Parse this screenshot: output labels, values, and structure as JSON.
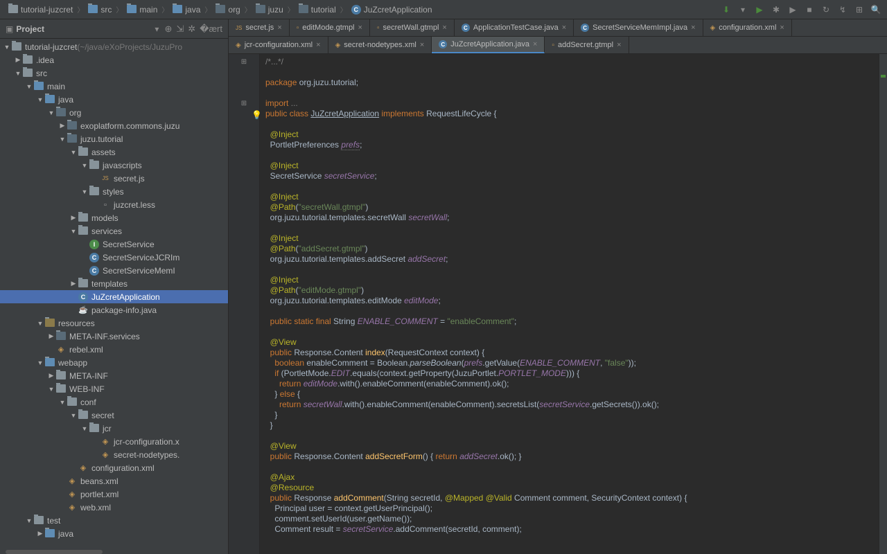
{
  "breadcrumb": [
    {
      "icon": "folder",
      "label": "tutorial-juzcret"
    },
    {
      "icon": "folder-src",
      "label": "src"
    },
    {
      "icon": "folder-src",
      "label": "main"
    },
    {
      "icon": "folder-src",
      "label": "java"
    },
    {
      "icon": "pkg",
      "label": "org"
    },
    {
      "icon": "pkg",
      "label": "juzu"
    },
    {
      "icon": "pkg",
      "label": "tutorial"
    },
    {
      "icon": "class",
      "label": "JuZcretApplication"
    }
  ],
  "sidebar": {
    "title": "Project",
    "toolIcons": [
      "target",
      "collapse",
      "gear",
      "hide"
    ]
  },
  "tree": [
    {
      "d": 0,
      "a": "v",
      "i": "folder",
      "l": "tutorial-juzcret",
      "suffix": " (~/java/eXoProjects/JuzuPro"
    },
    {
      "d": 1,
      "a": ">",
      "i": "folder",
      "l": ".idea"
    },
    {
      "d": 1,
      "a": "v",
      "i": "folder",
      "l": "src"
    },
    {
      "d": 2,
      "a": "v",
      "i": "folder-src",
      "l": "main"
    },
    {
      "d": 3,
      "a": "v",
      "i": "folder-src",
      "l": "java"
    },
    {
      "d": 4,
      "a": "v",
      "i": "pkg",
      "l": "org"
    },
    {
      "d": 5,
      "a": ">",
      "i": "pkg",
      "l": "exoplatform.commons.juzu"
    },
    {
      "d": 5,
      "a": "v",
      "i": "pkg",
      "l": "juzu.tutorial"
    },
    {
      "d": 6,
      "a": "v",
      "i": "folder",
      "l": "assets"
    },
    {
      "d": 7,
      "a": "v",
      "i": "folder",
      "l": "javascripts"
    },
    {
      "d": 8,
      "a": "",
      "i": "js",
      "l": "secret.js"
    },
    {
      "d": 7,
      "a": "v",
      "i": "folder",
      "l": "styles"
    },
    {
      "d": 8,
      "a": "",
      "i": "file",
      "l": "juzcret.less"
    },
    {
      "d": 6,
      "a": ">",
      "i": "folder",
      "l": "models"
    },
    {
      "d": 6,
      "a": "v",
      "i": "folder",
      "l": "services"
    },
    {
      "d": 7,
      "a": "",
      "i": "int",
      "l": "SecretService"
    },
    {
      "d": 7,
      "a": "",
      "i": "class",
      "l": "SecretServiceJCRIm"
    },
    {
      "d": 7,
      "a": "",
      "i": "class",
      "l": "SecretServiceMemI"
    },
    {
      "d": 6,
      "a": ">",
      "i": "folder",
      "l": "templates"
    },
    {
      "d": 6,
      "a": "",
      "i": "class",
      "l": "JuZcretApplication",
      "sel": true
    },
    {
      "d": 6,
      "a": "",
      "i": "java",
      "l": "package-info.java"
    },
    {
      "d": 3,
      "a": "v",
      "i": "folder-res",
      "l": "resources"
    },
    {
      "d": 4,
      "a": ">",
      "i": "pkg",
      "l": "META-INF.services"
    },
    {
      "d": 4,
      "a": "",
      "i": "xml",
      "l": "rebel.xml"
    },
    {
      "d": 3,
      "a": "v",
      "i": "folder-src",
      "l": "webapp"
    },
    {
      "d": 4,
      "a": ">",
      "i": "folder",
      "l": "META-INF"
    },
    {
      "d": 4,
      "a": "v",
      "i": "folder",
      "l": "WEB-INF"
    },
    {
      "d": 5,
      "a": "v",
      "i": "folder",
      "l": "conf"
    },
    {
      "d": 6,
      "a": "v",
      "i": "folder",
      "l": "secret"
    },
    {
      "d": 7,
      "a": "v",
      "i": "folder",
      "l": "jcr"
    },
    {
      "d": 8,
      "a": "",
      "i": "xml",
      "l": "jcr-configuration.x"
    },
    {
      "d": 8,
      "a": "",
      "i": "xml",
      "l": "secret-nodetypes."
    },
    {
      "d": 6,
      "a": "",
      "i": "xml",
      "l": "configuration.xml"
    },
    {
      "d": 5,
      "a": "",
      "i": "xml",
      "l": "beans.xml"
    },
    {
      "d": 5,
      "a": "",
      "i": "xml",
      "l": "portlet.xml"
    },
    {
      "d": 5,
      "a": "",
      "i": "xml",
      "l": "web.xml"
    },
    {
      "d": 2,
      "a": "v",
      "i": "folder",
      "l": "test"
    },
    {
      "d": 3,
      "a": ">",
      "i": "folder-src",
      "l": "java"
    }
  ],
  "tabsRow1": [
    {
      "icon": "js",
      "label": "secret.js",
      "close": true
    },
    {
      "icon": "gt",
      "label": "editMode.gtmpl",
      "close": true
    },
    {
      "icon": "gt",
      "label": "secretWall.gtmpl",
      "close": true
    },
    {
      "icon": "java",
      "label": "ApplicationTestCase.java",
      "close": true
    },
    {
      "icon": "java",
      "label": "SecretServiceMemImpl.java",
      "close": true
    },
    {
      "icon": "xml",
      "label": "configuration.xml",
      "close": true
    }
  ],
  "tabsRow2": [
    {
      "icon": "xml",
      "label": "jcr-configuration.xml",
      "close": true
    },
    {
      "icon": "xml",
      "label": "secret-nodetypes.xml",
      "close": true
    },
    {
      "icon": "java",
      "label": "JuZcretApplication.java",
      "close": true,
      "active": true
    },
    {
      "icon": "gt",
      "label": "addSecret.gtmpl",
      "close": true
    }
  ],
  "code": {
    "lines": [
      {
        "t": "fold",
        "s": "<span class='cmt'>/*...*/</span>"
      },
      {
        "t": "",
        "s": ""
      },
      {
        "t": "",
        "s": "<span class='kw'>package</span> org.juzu.tutorial;"
      },
      {
        "t": "",
        "s": ""
      },
      {
        "t": "fold",
        "s": "<span class='kw'>import</span> <span class='cmt'>...</span>"
      },
      {
        "t": "bulb",
        "s": ""
      },
      {
        "t": "",
        "s": "<span class='kw'>public class</span> <span class='cls'>JuZcretApplication</span> <span class='kw'>implements</span> RequestLifeCycle {"
      },
      {
        "t": "",
        "s": ""
      },
      {
        "t": "",
        "s": "  <span class='ann'>@Inject</span>"
      },
      {
        "t": "",
        "s": "  PortletPreferences <span class='fld-u'>prefs</span>;"
      },
      {
        "t": "",
        "s": ""
      },
      {
        "t": "",
        "s": "  <span class='ann'>@Inject</span>"
      },
      {
        "t": "",
        "s": "  SecretService <span class='fld'>secretService</span>;"
      },
      {
        "t": "",
        "s": ""
      },
      {
        "t": "",
        "s": "  <span class='ann'>@Inject</span>"
      },
      {
        "t": "",
        "s": "  <span class='ann'>@Path</span>(<span class='str'>\"secretWall.gtmpl\"</span>)"
      },
      {
        "t": "",
        "s": "  org.juzu.tutorial.templates.secretWall <span class='fld'>secretWall</span>;"
      },
      {
        "t": "",
        "s": ""
      },
      {
        "t": "",
        "s": "  <span class='ann'>@Inject</span>"
      },
      {
        "t": "",
        "s": "  <span class='ann'>@Path</span>(<span class='str'>\"addSecret.gtmpl\"</span>)"
      },
      {
        "t": "",
        "s": "  org.juzu.tutorial.templates.addSecret <span class='fld'>addSecret</span>;"
      },
      {
        "t": "",
        "s": ""
      },
      {
        "t": "",
        "s": "  <span class='ann'>@Inject</span>"
      },
      {
        "t": "",
        "s": "  <span class='ann'>@Path</span>(<span class='str'>\"editMode.gtmpl\"</span>)"
      },
      {
        "t": "",
        "s": "  org.juzu.tutorial.templates.editMode <span class='fld'>editMode</span>;"
      },
      {
        "t": "",
        "s": ""
      },
      {
        "t": "",
        "s": "  <span class='kw'>public static final</span> String <span class='const'>ENABLE_COMMENT</span> = <span class='str'>\"enableComment\"</span>;"
      },
      {
        "t": "",
        "s": ""
      },
      {
        "t": "",
        "s": "  <span class='ann'>@View</span>"
      },
      {
        "t": "",
        "s": "  <span class='kw'>public</span> Response.Content <span class='mth'>index</span>(RequestContext context) {"
      },
      {
        "t": "",
        "s": "    <span class='kw'>boolean</span> enableComment = Boolean.<span style='font-style:italic'>parseBoolean</span>(<span class='fld'>prefs</span>.getValue(<span class='const'>ENABLE_COMMENT</span>, <span class='str'>\"false\"</span>));"
      },
      {
        "t": "",
        "s": "    <span class='kw'>if</span> (PortletMode.<span class='const'>EDIT</span>.equals(context.getProperty(JuzuPortlet.<span class='const'>PORTLET_MODE</span>))) {"
      },
      {
        "t": "",
        "s": "      <span class='kw'>return</span> <span class='fld'>editMode</span>.with().enableComment(enableComment).ok();"
      },
      {
        "t": "",
        "s": "    } <span class='kw'>else</span> {"
      },
      {
        "t": "",
        "s": "      <span class='kw'>return</span> <span class='fld'>secretWall</span>.with().enableComment(enableComment).secretsList(<span class='fld'>secretService</span>.getSecrets()).ok();"
      },
      {
        "t": "",
        "s": "    }"
      },
      {
        "t": "",
        "s": "  }"
      },
      {
        "t": "",
        "s": ""
      },
      {
        "t": "",
        "s": "  <span class='ann'>@View</span>"
      },
      {
        "t": "",
        "s": "  <span class='kw'>public</span> Response.Content <span class='mth'>addSecretForm</span>() { <span class='kw'>return</span> <span class='fld'>addSecret</span>.ok(); }"
      },
      {
        "t": "",
        "s": ""
      },
      {
        "t": "",
        "s": "  <span class='ann'>@Ajax</span>"
      },
      {
        "t": "",
        "s": "  <span class='ann'>@Resource</span>"
      },
      {
        "t": "",
        "s": "  <span class='kw'>public</span> Response <span class='mth'>addComment</span>(String secretId, <span class='ann'>@Mapped</span> <span class='ann'>@Valid</span> Comment comment, SecurityContext context) {"
      },
      {
        "t": "",
        "s": "    Principal user = context.getUserPrincipal();"
      },
      {
        "t": "",
        "s": "    comment.setUserId(user.getName());"
      },
      {
        "t": "",
        "s": "    Comment result = <span class='fld'>secretService</span>.addComment(secretId, comment);"
      }
    ]
  }
}
